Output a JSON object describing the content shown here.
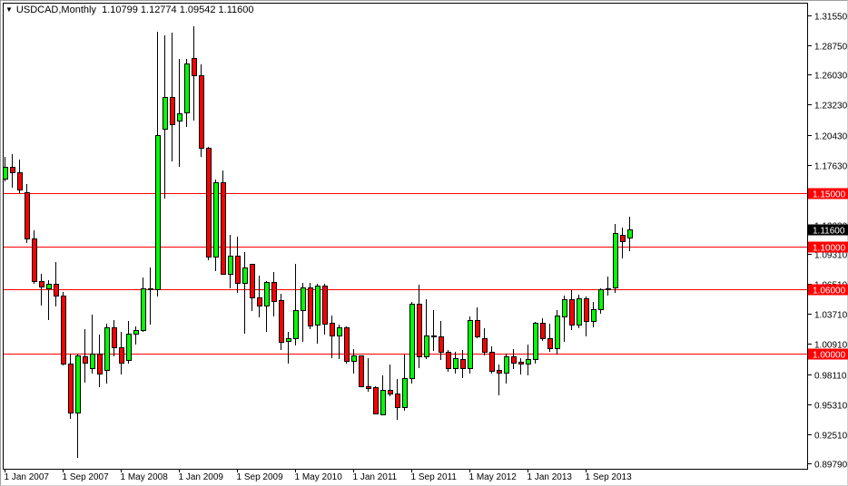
{
  "header": {
    "symbol": "USDCAD,Monthly",
    "ohlc": "1.10799 1.12774 1.09542 1.11600",
    "menu_icon": "triangle-down-icon"
  },
  "chart_data": {
    "type": "candlestick",
    "symbol": "USDCAD",
    "timeframe": "Monthly",
    "first_period": "Jan 2007",
    "period": "month",
    "colors": {
      "up": "#00ff00",
      "down": "#ff0000",
      "outline": "#000000",
      "level_line": "#ff0000",
      "current_label": "#000000"
    },
    "ylim": [
      0.8979,
      1.3155
    ],
    "y_ticks": [
      "1.31550",
      "1.28750",
      "1.26030",
      "1.23230",
      "1.20430",
      "1.17630",
      "1.12030",
      "1.09310",
      "1.06510",
      "1.03710",
      "1.00910",
      "0.98110",
      "0.95310",
      "0.92510",
      "0.89790"
    ],
    "x_ticks": [
      {
        "index": 0,
        "label": "1 Jan 2007"
      },
      {
        "index": 8,
        "label": "1 Sep 2007"
      },
      {
        "index": 16,
        "label": "1 May 2008"
      },
      {
        "index": 24,
        "label": "1 Jan 2009"
      },
      {
        "index": 32,
        "label": "1 Sep 2009"
      },
      {
        "index": 40,
        "label": "1 May 2010"
      },
      {
        "index": 48,
        "label": "1 Jan 2011"
      },
      {
        "index": 56,
        "label": "1 Sep 2011"
      },
      {
        "index": 64,
        "label": "1 May 2012"
      },
      {
        "index": 72,
        "label": "1 Jan 2013"
      },
      {
        "index": 80,
        "label": "1 Sep 2013"
      }
    ],
    "levels": [
      "1.15000",
      "1.10000",
      "1.06000",
      "1.00000"
    ],
    "current_price": "1.11600",
    "ohlc_columns": [
      "open",
      "high",
      "low",
      "close"
    ],
    "candles": [
      [
        1.1633,
        1.1836,
        1.1607,
        1.1743
      ],
      [
        1.1743,
        1.186,
        1.1548,
        1.1692
      ],
      [
        1.1692,
        1.181,
        1.1497,
        1.1531
      ],
      [
        1.1506,
        1.1582,
        1.1033,
        1.1075
      ],
      [
        1.1075,
        1.1151,
        1.0652,
        1.0677
      ],
      [
        1.0677,
        1.0745,
        1.0449,
        1.0627
      ],
      [
        1.061,
        1.0686,
        1.0314,
        1.0652
      ],
      [
        1.0652,
        1.0855,
        1.0441,
        1.0542
      ],
      [
        1.0542,
        1.0576,
        0.9892,
        0.9908
      ],
      [
        0.9908,
        0.9999,
        0.9393,
        0.9452
      ],
      [
        0.9452,
        1.0,
        0.903,
        0.9985
      ],
      [
        0.9976,
        1.023,
        0.9731,
        0.9917
      ],
      [
        0.9866,
        1.0365,
        0.9816,
        1.0001
      ],
      [
        1.0001,
        1.0179,
        0.9689,
        0.9816
      ],
      [
        0.9849,
        1.028,
        0.9723,
        1.0247
      ],
      [
        1.0247,
        1.0314,
        0.9976,
        1.0061
      ],
      [
        1.0061,
        1.0204,
        0.9807,
        0.9917
      ],
      [
        0.9942,
        1.0306,
        0.9908,
        1.0187
      ],
      [
        1.0187,
        1.0255,
        1.0086,
        1.0221
      ],
      [
        1.0221,
        1.0711,
        1.0204,
        1.061
      ],
      [
        1.0602,
        1.0804,
        1.0271,
        1.061
      ],
      [
        1.0602,
        1.3003,
        1.0534,
        1.2039
      ],
      [
        1.2098,
        1.2969,
        1.1449,
        1.2394
      ],
      [
        1.2394,
        1.2994,
        1.1796,
        1.2143
      ],
      [
        1.2177,
        1.2752,
        1.1743,
        1.2244
      ],
      [
        1.2253,
        1.2752,
        1.2118,
        1.2709
      ],
      [
        1.276,
        1.3054,
        1.2177,
        1.26
      ],
      [
        1.26,
        1.2701,
        1.1836,
        1.1919
      ],
      [
        1.1919,
        1.1928,
        1.0872,
        1.0906
      ],
      [
        1.0906,
        1.1624,
        1.077,
        1.1599
      ],
      [
        1.1599,
        1.1709,
        1.0736,
        1.0745
      ],
      [
        1.0745,
        1.1109,
        1.061,
        1.0914
      ],
      [
        1.0914,
        1.1092,
        1.0568,
        1.0661
      ],
      [
        1.0661,
        1.0948,
        1.0187,
        1.0804
      ],
      [
        1.0838,
        1.0838,
        1.0398,
        1.0525
      ],
      [
        1.0525,
        1.0728,
        1.0339,
        1.0449
      ],
      [
        1.0449,
        1.0677,
        1.0204,
        1.0669
      ],
      [
        1.0669,
        1.0762,
        1.0348,
        1.0491
      ],
      [
        1.05,
        1.0559,
        1.0035,
        1.0111
      ],
      [
        1.012,
        1.0204,
        0.9908,
        1.0145
      ],
      [
        1.0145,
        1.0838,
        1.0077,
        1.0407
      ],
      [
        1.0407,
        1.0661,
        1.0111,
        1.0618
      ],
      [
        1.0618,
        1.0661,
        1.023,
        1.0263
      ],
      [
        1.0272,
        1.0652,
        1.0094,
        1.0635
      ],
      [
        1.0635,
        1.0652,
        1.0179,
        1.028
      ],
      [
        1.0289,
        1.0356,
        0.9959,
        1.017
      ],
      [
        1.017,
        1.0272,
        0.9951,
        1.0247
      ],
      [
        1.0247,
        1.0255,
        0.9908,
        0.9934
      ],
      [
        0.9934,
        1.0044,
        0.9816,
        0.9985
      ],
      [
        0.9985,
        0.9985,
        0.9689,
        0.9697
      ],
      [
        0.9697,
        0.9959,
        0.9647,
        0.968
      ],
      [
        0.9689,
        0.9697,
        0.9436,
        0.9444
      ],
      [
        0.9436,
        0.9799,
        0.9427,
        0.9664
      ],
      [
        0.9664,
        0.9901,
        0.9605,
        0.963
      ],
      [
        0.963,
        0.9765,
        0.9385,
        0.9503
      ],
      [
        0.9503,
        0.9993,
        0.9469,
        0.9773
      ],
      [
        0.9773,
        1.0483,
        0.9723,
        1.0466
      ],
      [
        1.0466,
        1.0643,
        0.9866,
        0.9976
      ],
      [
        0.9976,
        1.0508,
        0.9951,
        1.017
      ],
      [
        1.017,
        1.0407,
        1.0027,
        1.0162
      ],
      [
        1.0162,
        1.0305,
        0.9942,
        1.0018
      ],
      [
        1.0018,
        1.0035,
        0.9833,
        0.9866
      ],
      [
        0.9866,
        1.0018,
        0.9816,
        0.9959
      ],
      [
        0.9951,
        1.0035,
        0.9773,
        0.9866
      ],
      [
        0.9866,
        1.0348,
        0.9816,
        1.0314
      ],
      [
        1.0314,
        1.0432,
        1.0145,
        1.0162
      ],
      [
        1.0145,
        1.0238,
        0.9985,
        1.0018
      ],
      [
        1.0018,
        1.0069,
        0.9816,
        0.9841
      ],
      [
        0.9849,
        0.9901,
        0.9613,
        0.9824
      ],
      [
        0.9824,
        1.0002,
        0.9723,
        0.9976
      ],
      [
        0.9976,
        1.0044,
        0.9858,
        0.9917
      ],
      [
        0.9925,
        0.9959,
        0.9807,
        0.9908
      ],
      [
        0.9908,
        1.0086,
        0.9799,
        0.9951
      ],
      [
        0.9951,
        1.0297,
        0.9908,
        1.0289
      ],
      [
        1.0289,
        1.0331,
        1.012,
        1.0145
      ],
      [
        1.0145,
        1.028,
        1.0018,
        1.0052
      ],
      [
        1.0052,
        1.0407,
        0.9993,
        1.0356
      ],
      [
        1.0348,
        1.0542,
        1.0111,
        1.0508
      ],
      [
        1.0508,
        1.0593,
        1.0221,
        1.0272
      ],
      [
        1.0272,
        1.0551,
        1.0238,
        1.0517
      ],
      [
        1.0517,
        1.0534,
        1.0162,
        1.0305
      ],
      [
        1.0305,
        1.0483,
        1.0246,
        1.0415
      ],
      [
        1.0415,
        1.061,
        1.0373,
        1.0602
      ],
      [
        1.0602,
        1.072,
        1.0542,
        1.061
      ],
      [
        1.0618,
        1.121,
        1.0568,
        1.1126
      ],
      [
        1.1109,
        1.1177,
        1.0889,
        1.105
      ],
      [
        1.10799,
        1.12774,
        1.09542,
        1.116
      ]
    ]
  }
}
